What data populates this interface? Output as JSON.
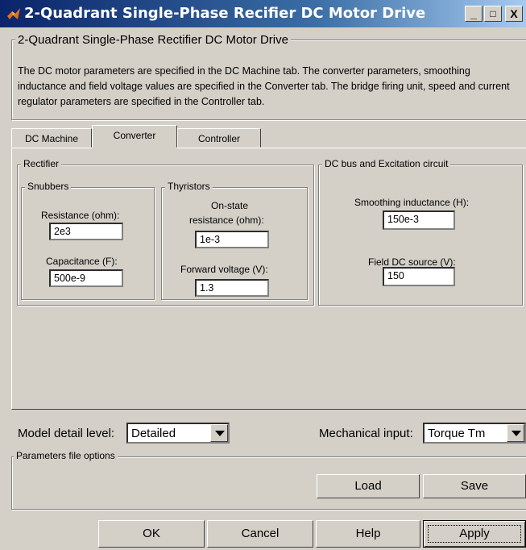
{
  "window": {
    "title": "2-Quadrant Single-Phase Recifier DC Motor Drive",
    "minimize_label": "_",
    "maximize_label": "□",
    "close_label": "X"
  },
  "block": {
    "group_title": "2-Quadrant Single-Phase Rectifier DC Motor Drive",
    "description": "The DC motor parameters are specified in the DC Machine tab. The converter parameters, smoothing inductance and field voltage values are specified in the Converter tab. The bridge firing unit, speed and current regulator parameters are specified in the Controller tab."
  },
  "tabs": [
    {
      "label": "DC Machine",
      "active": false
    },
    {
      "label": "Converter",
      "active": true
    },
    {
      "label": "Controller",
      "active": false
    }
  ],
  "rectifier": {
    "title": "Rectifier",
    "snubbers": {
      "title": "Snubbers",
      "resistance_label": "Resistance (ohm):",
      "resistance_value": "2e3",
      "capacitance_label": "Capacitance (F):",
      "capacitance_value": "500e-9"
    },
    "thyristors": {
      "title": "Thyristors",
      "onstate_label_1": "On-state",
      "onstate_label_2": "resistance (ohm):",
      "onstate_value": "1e-3",
      "forward_label": "Forward voltage (V):",
      "forward_value": "1.3"
    }
  },
  "dcbus": {
    "title": "DC bus and Excitation circuit",
    "smoothing_label": "Smoothing inductance (H):",
    "smoothing_value": "150e-3",
    "field_label": "Field DC source (V):",
    "field_value": "150"
  },
  "model_detail": {
    "label": "Model detail level:",
    "value": "Detailed"
  },
  "mechanical_input": {
    "label": "Mechanical input:",
    "value": "Torque Tm"
  },
  "params_file": {
    "title": "Parameters file options",
    "load_label": "Load",
    "save_label": "Save"
  },
  "buttons": {
    "ok": "OK",
    "cancel": "Cancel",
    "help": "Help",
    "apply": "Apply"
  },
  "colors": {
    "title_start": "#0a246a",
    "title_end": "#a6caf0",
    "face": "#d4d0c8"
  }
}
